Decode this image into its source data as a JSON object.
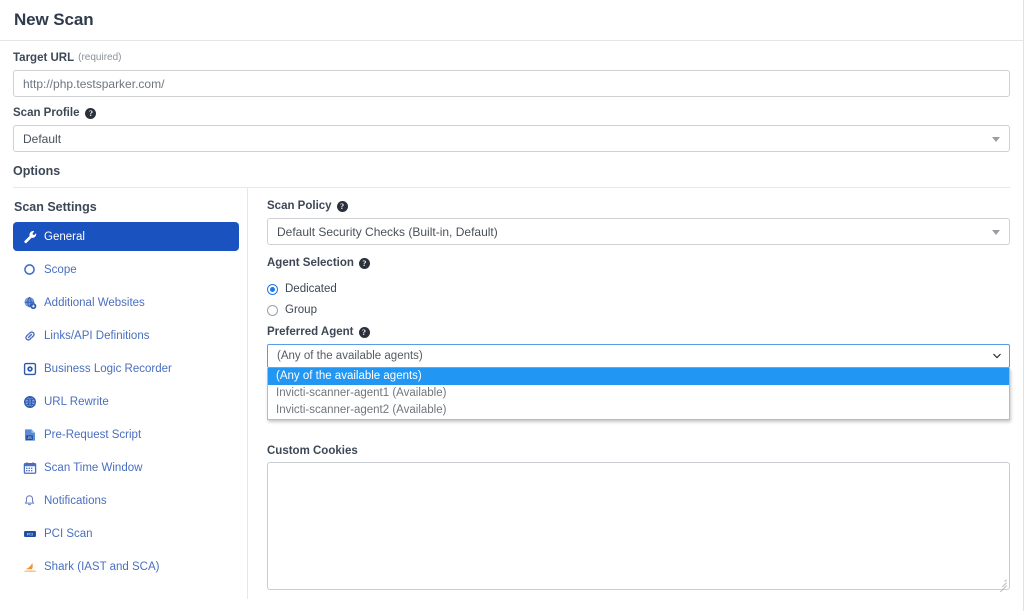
{
  "header": {
    "title": "New Scan"
  },
  "form": {
    "target_url": {
      "label": "Target URL",
      "required_note": "(required)",
      "value": "http://php.testsparker.com/"
    },
    "scan_profile": {
      "label": "Scan Profile",
      "help": "?",
      "value": "Default"
    },
    "options_heading": "Options"
  },
  "sidebar": {
    "title": "Scan Settings",
    "items": [
      {
        "label": "General",
        "icon": "wrench-icon",
        "active": true
      },
      {
        "label": "Scope",
        "icon": "circle-scope-icon",
        "active": false
      },
      {
        "label": "Additional Websites",
        "icon": "globe-add-icon",
        "active": false
      },
      {
        "label": "Links/API Definitions",
        "icon": "link-chain-icon",
        "active": false
      },
      {
        "label": "Business Logic Recorder",
        "icon": "record-square-icon",
        "active": false
      },
      {
        "label": "URL Rewrite",
        "icon": "globe-rewrite-icon",
        "active": false
      },
      {
        "label": "Pre-Request Script",
        "icon": "js-script-icon",
        "active": false
      },
      {
        "label": "Scan Time Window",
        "icon": "calendar-icon",
        "active": false
      },
      {
        "label": "Notifications",
        "icon": "bell-icon",
        "active": false
      },
      {
        "label": "PCI Scan",
        "icon": "pci-card-icon",
        "active": false
      },
      {
        "label": "Shark (IAST and SCA)",
        "icon": "shark-fin-icon",
        "active": false
      }
    ]
  },
  "main": {
    "scan_policy": {
      "label": "Scan Policy",
      "help": "?",
      "value": "Default Security Checks (Built-in, Default)"
    },
    "agent_selection": {
      "label": "Agent Selection",
      "help": "?",
      "options": [
        {
          "label": "Dedicated",
          "checked": true
        },
        {
          "label": "Group",
          "checked": false
        }
      ]
    },
    "preferred_agent": {
      "label": "Preferred Agent",
      "help": "?",
      "value": "(Any of the available agents)",
      "expanded": true,
      "options": [
        {
          "label": "(Any of the available agents)",
          "selected": true
        },
        {
          "label": "Invicti-scanner-agent1 (Available)",
          "selected": false
        },
        {
          "label": "Invicti-scanner-agent2 (Available)",
          "selected": false
        }
      ]
    },
    "custom_cookies": {
      "label": "Custom Cookies",
      "value": "",
      "placeholder": ""
    }
  },
  "colors": {
    "accent_blue": "#1a53c0",
    "link_blue": "#4a6fbf",
    "highlight_blue": "#2196f3",
    "shark_orange": "#f0952e",
    "text_dark": "#3d4856"
  }
}
